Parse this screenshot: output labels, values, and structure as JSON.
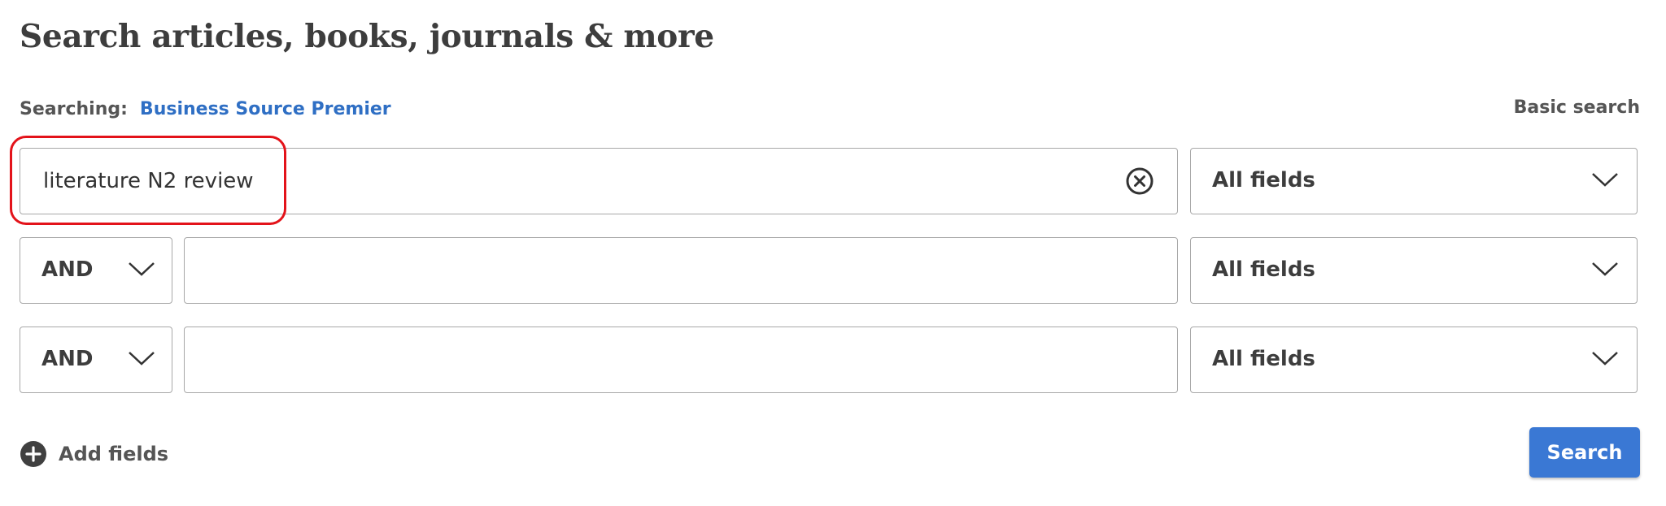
{
  "header": {
    "title": "Search articles, books, journals & more"
  },
  "scope": {
    "label": "Searching:",
    "database": "Business Source Premier"
  },
  "links": {
    "basic_search": "Basic search"
  },
  "rows": [
    {
      "operator": null,
      "value": "literature N2 review",
      "placeholder": "",
      "field": "All fields"
    },
    {
      "operator": "AND",
      "value": "",
      "placeholder": "",
      "field": "All fields"
    },
    {
      "operator": "AND",
      "value": "",
      "placeholder": "",
      "field": "All fields"
    }
  ],
  "actions": {
    "add_fields": "Add fields",
    "search": "Search"
  },
  "colors": {
    "link": "#2f6fc4",
    "primary_button": "#3a78d4",
    "highlight": "#e3131a",
    "border": "#a8a8a8"
  },
  "icons": {
    "clear": "circle-x-icon",
    "dropdown": "chevron-down-icon",
    "add": "plus-circle-icon"
  }
}
